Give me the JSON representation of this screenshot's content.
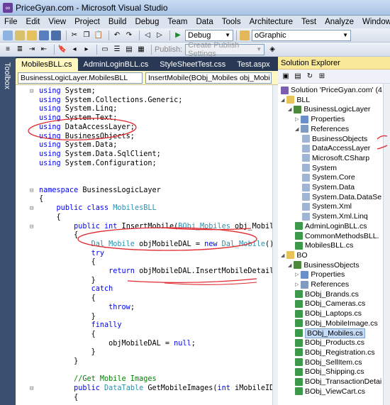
{
  "window": {
    "title": "PriceGyan.com - Microsoft Visual Studio",
    "icon": "vs-logo-icon"
  },
  "menu": [
    "File",
    "Edit",
    "View",
    "Project",
    "Build",
    "Debug",
    "Team",
    "Data",
    "Tools",
    "Architecture",
    "Test",
    "Analyze",
    "Window",
    "Help"
  ],
  "toolbar": {
    "config": "Debug",
    "target": "oGraphic",
    "publish_label": "Publish:",
    "publish_settings": "Create Publish Settings"
  },
  "toolbox_label": "Toolbox",
  "tabs": [
    {
      "label": "MobilesBLL.cs",
      "active": true
    },
    {
      "label": "AdminLoginBLL.cs"
    },
    {
      "label": "StyleSheetTest.css"
    },
    {
      "label": "Test.aspx"
    }
  ],
  "nav": {
    "class_combo": "BusinessLogicLayer.MobilesBLL",
    "member_combo": "InsertMobile(BObj_Mobiles obj_Mobi"
  },
  "code": [
    [
      {
        "t": "using",
        "c": "kw"
      },
      {
        "t": " System;"
      }
    ],
    [
      {
        "t": "using",
        "c": "kw"
      },
      {
        "t": " System.Collections.Generic;"
      }
    ],
    [
      {
        "t": "using",
        "c": "kw"
      },
      {
        "t": " System.Linq;"
      }
    ],
    [
      {
        "t": "using",
        "c": "kw"
      },
      {
        "t": " System.Text;"
      }
    ],
    [
      {
        "t": "using",
        "c": "kw"
      },
      {
        "t": " DataAccessLayer;"
      }
    ],
    [
      {
        "t": "using",
        "c": "kw"
      },
      {
        "t": " BusinessObjects;"
      }
    ],
    [
      {
        "t": "using",
        "c": "kw"
      },
      {
        "t": " System.Data;"
      }
    ],
    [
      {
        "t": "using",
        "c": "kw"
      },
      {
        "t": " System.Data.SqlClient;"
      }
    ],
    [
      {
        "t": "using",
        "c": "kw"
      },
      {
        "t": " System.Configuration;"
      }
    ],
    [],
    [],
    [
      {
        "t": "namespace",
        "c": "kw"
      },
      {
        "t": " BusinessLogicLayer"
      }
    ],
    [
      {
        "t": "{"
      }
    ],
    [
      {
        "t": "    "
      },
      {
        "t": "public class",
        "c": "kw"
      },
      {
        "t": " "
      },
      {
        "t": "MobilesBLL",
        "c": "ty"
      }
    ],
    [
      {
        "t": "    {"
      }
    ],
    [
      {
        "t": "        "
      },
      {
        "t": "public int",
        "c": "kw"
      },
      {
        "t": " InsertMobile("
      },
      {
        "t": "BObj_Mobiles",
        "c": "ty"
      },
      {
        "t": " obj_Mobiles)"
      }
    ],
    [
      {
        "t": "        {"
      }
    ],
    [
      {
        "t": "            "
      },
      {
        "t": "Dal_Mobile",
        "c": "ty"
      },
      {
        "t": " objMobileDAL = "
      },
      {
        "t": "new",
        "c": "kw"
      },
      {
        "t": " "
      },
      {
        "t": "Dal_Mobile",
        "c": "ty"
      },
      {
        "t": "();"
      }
    ],
    [
      {
        "t": "            "
      },
      {
        "t": "try",
        "c": "kw"
      }
    ],
    [
      {
        "t": "            {"
      }
    ],
    [
      {
        "t": "                "
      },
      {
        "t": "return",
        "c": "kw"
      },
      {
        "t": " objMobileDAL.InsertMobileDetail(obj_M"
      }
    ],
    [
      {
        "t": "            }"
      }
    ],
    [
      {
        "t": "            "
      },
      {
        "t": "catch",
        "c": "kw"
      }
    ],
    [
      {
        "t": "            {"
      }
    ],
    [
      {
        "t": "                "
      },
      {
        "t": "throw",
        "c": "kw"
      },
      {
        "t": ";"
      }
    ],
    [
      {
        "t": "            }"
      }
    ],
    [
      {
        "t": "            "
      },
      {
        "t": "finally",
        "c": "kw"
      }
    ],
    [
      {
        "t": "            {"
      }
    ],
    [
      {
        "t": "                objMobileDAL = "
      },
      {
        "t": "null",
        "c": "kw"
      },
      {
        "t": ";"
      }
    ],
    [
      {
        "t": "            }"
      }
    ],
    [
      {
        "t": "        }"
      }
    ],
    [],
    [
      {
        "t": "        "
      },
      {
        "t": "//Get Mobile Images",
        "c": "cm"
      }
    ],
    [
      {
        "t": "        "
      },
      {
        "t": "public",
        "c": "kw"
      },
      {
        "t": " "
      },
      {
        "t": "DataTable",
        "c": "ty"
      },
      {
        "t": " GetMobileImages("
      },
      {
        "t": "int",
        "c": "kw"
      },
      {
        "t": " iMobileID)"
      }
    ],
    [
      {
        "t": "        {"
      }
    ]
  ],
  "solution_explorer": {
    "title": "Solution Explorer",
    "nodes": [
      {
        "label": "Solution 'PriceGyan.com' (4 proje",
        "level": 0,
        "icon": "solution-icon"
      },
      {
        "label": "BLL",
        "level": 0,
        "icon": "folder-icon",
        "exp": "-"
      },
      {
        "label": "BusinessLogicLayer",
        "level": 1,
        "icon": "project-icon",
        "exp": "-"
      },
      {
        "label": "Properties",
        "level": 2,
        "icon": "properties-icon",
        "exp": "+"
      },
      {
        "label": "References",
        "level": 2,
        "icon": "references-icon",
        "exp": "-"
      },
      {
        "label": "BusinessObjects",
        "level": 3,
        "icon": "reference-icon"
      },
      {
        "label": "DataAccessLayer",
        "level": 3,
        "icon": "reference-icon"
      },
      {
        "label": "Microsoft.CSharp",
        "level": 3,
        "icon": "reference-icon"
      },
      {
        "label": "System",
        "level": 3,
        "icon": "reference-icon"
      },
      {
        "label": "System.Core",
        "level": 3,
        "icon": "reference-icon"
      },
      {
        "label": "System.Data",
        "level": 3,
        "icon": "reference-icon"
      },
      {
        "label": "System.Data.DataSe",
        "level": 3,
        "icon": "reference-icon"
      },
      {
        "label": "System.Xml",
        "level": 3,
        "icon": "reference-icon"
      },
      {
        "label": "System.Xml.Linq",
        "level": 3,
        "icon": "reference-icon"
      },
      {
        "label": "AdminLoginBLL.cs",
        "level": 2,
        "icon": "cs-file-icon"
      },
      {
        "label": "CommonMethodsBLL.",
        "level": 2,
        "icon": "cs-file-icon"
      },
      {
        "label": "MobilesBLL.cs",
        "level": 2,
        "icon": "cs-file-icon"
      },
      {
        "label": "BO",
        "level": 0,
        "icon": "folder-icon",
        "exp": "-"
      },
      {
        "label": "BusinessObjects",
        "level": 1,
        "icon": "project-icon",
        "exp": "-"
      },
      {
        "label": "Properties",
        "level": 2,
        "icon": "properties-icon",
        "exp": "+"
      },
      {
        "label": "References",
        "level": 2,
        "icon": "references-icon",
        "exp": "+"
      },
      {
        "label": "BObj_Brands.cs",
        "level": 2,
        "icon": "cs-file-icon"
      },
      {
        "label": "BObj_Cameras.cs",
        "level": 2,
        "icon": "cs-file-icon"
      },
      {
        "label": "BObj_Laptops.cs",
        "level": 2,
        "icon": "cs-file-icon"
      },
      {
        "label": "BObj_MobileImage.cs",
        "level": 2,
        "icon": "cs-file-icon"
      },
      {
        "label": "BObj_Mobiles.cs",
        "level": 2,
        "icon": "cs-file-icon",
        "selected": true
      },
      {
        "label": "BObj_Products.cs",
        "level": 2,
        "icon": "cs-file-icon"
      },
      {
        "label": "BObj_Registration.cs",
        "level": 2,
        "icon": "cs-file-icon"
      },
      {
        "label": "BObj_SellItem.cs",
        "level": 2,
        "icon": "cs-file-icon"
      },
      {
        "label": "BObj_Shipping.cs",
        "level": 2,
        "icon": "cs-file-icon"
      },
      {
        "label": "BObj_TransactionDetai",
        "level": 2,
        "icon": "cs-file-icon"
      },
      {
        "label": "BObj_ViewCart.cs",
        "level": 2,
        "icon": "cs-file-icon"
      }
    ]
  },
  "colors": {
    "annotation": "#e0282e",
    "keyword": "#0000ff",
    "type": "#2b91af",
    "comment": "#008000"
  }
}
